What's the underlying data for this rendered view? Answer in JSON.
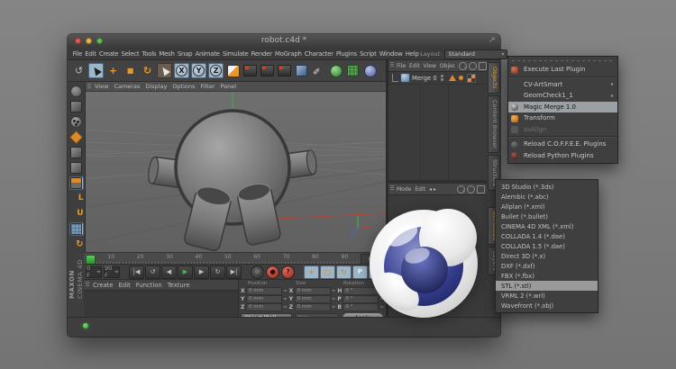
{
  "colors": {
    "accent_orange": "#e6982f",
    "selection_blue": "#9db6c9",
    "play_green": "#46b94a",
    "record_red": "#c0392b",
    "status_green": "#3dc13d",
    "panel_dark": "#3e3e3e",
    "viewport_gray": "#686868"
  },
  "window": {
    "title": "robot.c4d *",
    "resize_glyph": "↗",
    "menu_bar": [
      {
        "name": "menu-file",
        "label": "File"
      },
      {
        "name": "menu-edit",
        "label": "Edit"
      },
      {
        "name": "menu-create",
        "label": "Create"
      },
      {
        "name": "menu-select",
        "label": "Select"
      },
      {
        "name": "menu-tools",
        "label": "Tools"
      },
      {
        "name": "menu-mesh",
        "label": "Mesh"
      },
      {
        "name": "menu-snap",
        "label": "Snap"
      },
      {
        "name": "menu-animate",
        "label": "Animate"
      },
      {
        "name": "menu-simulate",
        "label": "Simulate"
      },
      {
        "name": "menu-render",
        "label": "Render"
      },
      {
        "name": "menu-mograph",
        "label": "MoGraph"
      },
      {
        "name": "menu-character",
        "label": "Character"
      },
      {
        "name": "menu-plugins",
        "label": "Plugins"
      },
      {
        "name": "menu-script",
        "label": "Script"
      },
      {
        "name": "menu-window",
        "label": "Window"
      },
      {
        "name": "menu-help",
        "label": "Help"
      }
    ],
    "layout_label": "Layout:",
    "layout_value": "Standard",
    "layout_caret": "▾"
  },
  "toolbar": {
    "tools": [
      {
        "name": "undo-icon",
        "glyph": "↺",
        "cls": "plain"
      },
      {
        "name": "live-selection-tool",
        "cls": "lit ptr",
        "active": true
      },
      {
        "name": "move-tool-icon",
        "glyph": "+",
        "cls": "orange"
      },
      {
        "name": "scale-tool-icon",
        "glyph": "■",
        "cls": "orange small"
      },
      {
        "name": "rotate-tool-icon",
        "glyph": "↻",
        "cls": "orange"
      },
      {
        "name": "last-tool-icon",
        "cls": "darklit ptr"
      },
      {
        "name": "x-axis-lock-button",
        "glyph": "X",
        "cls": "axis lit"
      },
      {
        "name": "y-axis-lock-button",
        "glyph": "Y",
        "cls": "axis lit"
      },
      {
        "name": "z-axis-lock-button",
        "glyph": "Z",
        "cls": "axis lit"
      },
      {
        "name": "coordinate-system-icon",
        "cls": "coordicon"
      },
      {
        "name": "render-view-icon",
        "cls": "clapper"
      },
      {
        "name": "render-region-icon",
        "cls": "clapper"
      },
      {
        "name": "render-settings-icon",
        "cls": "clapper"
      },
      {
        "name": "add-primitive-cube-icon",
        "cls": "cubeicon"
      },
      {
        "name": "spline-pen-icon",
        "glyph": "✎",
        "cls": "penicon"
      },
      {
        "name": "subdivision-surface-icon",
        "cls": "greenball"
      },
      {
        "name": "array-object-icon",
        "cls": "greenlattice"
      },
      {
        "name": "deformer-icon",
        "cls": "blueball"
      }
    ]
  },
  "palette": {
    "tools": [
      {
        "name": "make-editable-icon",
        "cls": "sgray"
      },
      {
        "name": "model-mode-icon",
        "cls": "cubepen"
      },
      {
        "name": "texture-mode-icon",
        "cls": "sdots"
      },
      {
        "name": "workplane-mode-icon",
        "cls": "polyorange"
      },
      {
        "name": "points-mode-icon",
        "cls": "cube"
      },
      {
        "name": "edges-mode-icon",
        "cls": "cube"
      },
      {
        "name": "polygons-mode-icon",
        "cls": "cubeorange",
        "active": true
      },
      {
        "name": "axis-mode-icon",
        "glyph": "L",
        "cls": "lorange"
      },
      {
        "name": "texture-axis-icon",
        "glyph": "U",
        "cls": "uorange"
      },
      {
        "name": "workplane-icon",
        "cls": "gridblue",
        "active": true
      },
      {
        "name": "snap-settings-icon",
        "glyph": "↻",
        "cls": "snaporange"
      }
    ],
    "brand_top": "MAXON",
    "brand_bottom": "CINEMA 4D"
  },
  "viewport": {
    "menu": [
      {
        "name": "vp-menu-view",
        "label": "View"
      },
      {
        "name": "vp-menu-cameras",
        "label": "Cameras"
      },
      {
        "name": "vp-menu-display",
        "label": "Display"
      },
      {
        "name": "vp-menu-options",
        "label": "Options"
      },
      {
        "name": "vp-menu-filter",
        "label": "Filter"
      },
      {
        "name": "vp-menu-panel",
        "label": "Panel"
      }
    ]
  },
  "timeline": {
    "tick_labels": [
      "10",
      "20",
      "30",
      "40",
      "50",
      "60",
      "70",
      "80",
      "90"
    ],
    "current_frame": "0 F"
  },
  "anim": {
    "start_frame": "0 F",
    "end_frame": "90 F",
    "transport": [
      {
        "name": "goto-start-button",
        "glyph": "|◀"
      },
      {
        "name": "play-backwards-button",
        "glyph": "↺"
      },
      {
        "name": "previous-frame-button",
        "glyph": "◀"
      },
      {
        "name": "play-button",
        "glyph": "▶",
        "cls": "play"
      },
      {
        "name": "next-frame-button",
        "glyph": "▶"
      },
      {
        "name": "play-loop-button",
        "glyph": "↻"
      },
      {
        "name": "goto-end-button",
        "glyph": "▶|"
      }
    ],
    "record": [
      {
        "name": "record-active-objects-button",
        "glyph": "⊘"
      },
      {
        "name": "autokey-button",
        "glyph": "●",
        "cls": "red"
      },
      {
        "name": "keyframe-selection-button",
        "glyph": "?",
        "cls": "red"
      }
    ],
    "keys": [
      {
        "name": "key-position-button",
        "glyph": "+"
      },
      {
        "name": "key-scale-button",
        "glyph": "□"
      },
      {
        "name": "key-rotation-button",
        "glyph": "↻"
      },
      {
        "name": "key-parameter-button",
        "glyph": "P",
        "cls": "white circP"
      },
      {
        "name": "key-pla-button",
        "glyph": "⠿"
      }
    ]
  },
  "material_manager": {
    "menu": [
      {
        "name": "mat-menu-create",
        "label": "Create"
      },
      {
        "name": "mat-menu-edit",
        "label": "Edit"
      },
      {
        "name": "mat-menu-function",
        "label": "Function"
      },
      {
        "name": "mat-menu-texture",
        "label": "Texture"
      }
    ]
  },
  "coordinates": {
    "headers": [
      "Position",
      "Size",
      "Rotation"
    ],
    "position": [
      {
        "axis": "X",
        "value": "0 mm"
      },
      {
        "axis": "Y",
        "value": "0 mm"
      },
      {
        "axis": "Z",
        "value": "0 mm"
      }
    ],
    "size": [
      {
        "axis": "X",
        "value": "0 mm"
      },
      {
        "axis": "Y",
        "value": "0 mm"
      },
      {
        "axis": "Z",
        "value": "0 mm"
      }
    ],
    "rotation": [
      {
        "axis": "H",
        "value": "0 °"
      },
      {
        "axis": "P",
        "value": "0 °"
      },
      {
        "axis": "B",
        "value": "0 °"
      }
    ],
    "transform_mode": "Object (Rel)",
    "size_mode": "Size",
    "apply_label": "Apply",
    "caret": "▾"
  },
  "object_manager": {
    "menu": [
      {
        "name": "om-menu-file",
        "label": "File"
      },
      {
        "name": "om-menu-edit",
        "label": "Edit"
      },
      {
        "name": "om-menu-view",
        "label": "View"
      },
      {
        "name": "om-menu-objects",
        "label": "Objec"
      }
    ],
    "object_label": "Merge 0"
  },
  "attribute_manager": {
    "menu": [
      {
        "name": "am-menu-mode",
        "label": "Mode"
      },
      {
        "name": "am-menu-edit",
        "label": "Edit"
      },
      {
        "name": "am-nav-arrows",
        "label": "◂ ▸"
      }
    ]
  },
  "side_tabs": {
    "items": [
      {
        "name": "tab-objects",
        "label": "Objects",
        "active": true
      },
      {
        "name": "tab-content-browser",
        "label": "Content Browser"
      },
      {
        "name": "tab-structure",
        "label": "Structure"
      },
      {
        "name": "tab-gap",
        "label": "",
        "cls": "spacer"
      },
      {
        "name": "tab-attributes",
        "label": "Attributes",
        "active": true
      },
      {
        "name": "tab-layers",
        "label": "Layers"
      }
    ]
  },
  "plugin_menu": {
    "items": [
      {
        "name": "plugin-execute-last",
        "label": "Execute Last Plugin",
        "cls": "has-exec sep-after"
      },
      {
        "name": "plugin-cv-artsmart",
        "label": "CV-ArtSmart",
        "submenu": true,
        "arrow": "▸"
      },
      {
        "name": "plugin-geomcheck",
        "label": "GeomCheck1_1",
        "submenu": true,
        "arrow": "▸"
      },
      {
        "name": "plugin-magic-merge",
        "label": "Magic Merge 1.0",
        "highlighted": true,
        "cls": "has-merge"
      },
      {
        "name": "plugin-transform",
        "label": "Transform",
        "cls": "has-transform"
      },
      {
        "name": "plugin-xsalign",
        "label": "xsAlign",
        "disabled": true,
        "cls": "has-xsalign sep-after"
      },
      {
        "name": "plugin-reload-coffee",
        "label": "Reload C.O.F.F.E.E. Plugins",
        "cls": "has-coffee"
      },
      {
        "name": "plugin-reload-python",
        "label": "Reload Python Plugins",
        "cls": "has-python"
      }
    ]
  },
  "format_menu": {
    "items": [
      {
        "name": "format-3ds",
        "label": "3D Studio (*.3ds)"
      },
      {
        "name": "format-abc",
        "label": "Alembic (*.abc)"
      },
      {
        "name": "format-allplan",
        "label": "Allplan (*.xml)"
      },
      {
        "name": "format-bullet",
        "label": "Bullet (*.bullet)"
      },
      {
        "name": "format-c4dxml",
        "label": "CINEMA 4D XML (*.xml)"
      },
      {
        "name": "format-collada14",
        "label": "COLLADA 1.4 (*.dae)"
      },
      {
        "name": "format-collada15",
        "label": "COLLADA 1.5 (*.dae)"
      },
      {
        "name": "format-direct3d",
        "label": "Direct 3D (*.x)"
      },
      {
        "name": "format-dxf",
        "label": "DXF (*.dxf)"
      },
      {
        "name": "format-fbx",
        "label": "FBX (*.fbx)"
      },
      {
        "name": "format-stl",
        "label": "STL (*.stl)",
        "highlighted": true
      },
      {
        "name": "format-vrml",
        "label": "VRML 2 (*.wrl)"
      },
      {
        "name": "format-obj",
        "label": "Wavefront (*.obj)"
      }
    ]
  }
}
